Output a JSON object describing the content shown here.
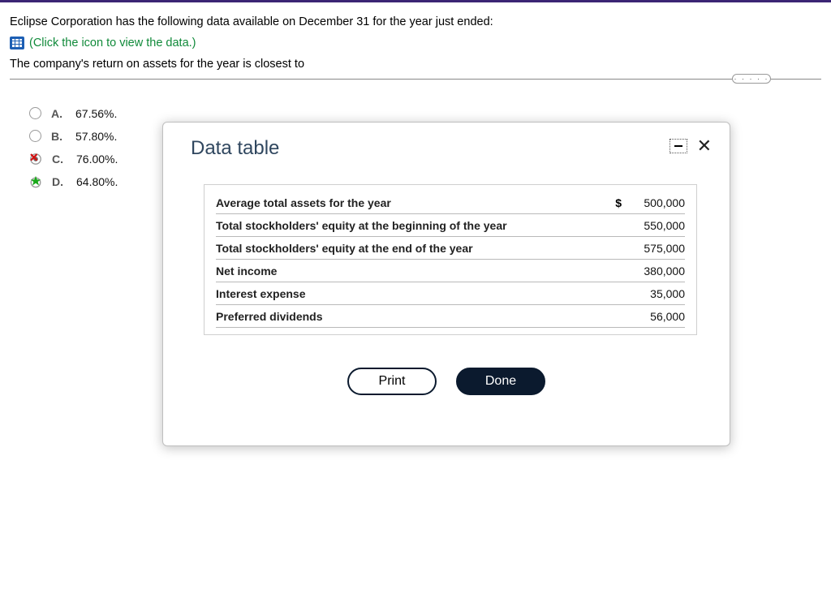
{
  "question": {
    "intro": "Eclipse Corporation has the following data available on December 31 for the year just ended:",
    "click_hint": "(Click the icon to view the data.)",
    "prompt": "The company's return on assets for the year is closest to"
  },
  "options": [
    {
      "letter": "A.",
      "text": "67.56%.",
      "state": "empty"
    },
    {
      "letter": "B.",
      "text": "57.80%.",
      "state": "empty"
    },
    {
      "letter": "C.",
      "text": "76.00%.",
      "state": "wrong"
    },
    {
      "letter": "D.",
      "text": "64.80%.",
      "state": "correct"
    }
  ],
  "modal": {
    "title": "Data table",
    "buttons": {
      "print": "Print",
      "done": "Done"
    }
  },
  "dots": "· · · · ·",
  "chart_data": {
    "type": "table",
    "title": "Data table",
    "currency_symbol": "$",
    "rows": [
      {
        "label": "Average total assets for the year",
        "show_currency": true,
        "value": "500,000"
      },
      {
        "label": "Total stockholders' equity at the beginning of the year",
        "show_currency": false,
        "value": "550,000"
      },
      {
        "label": "Total stockholders' equity at the end of the year",
        "show_currency": false,
        "value": "575,000"
      },
      {
        "label": "Net income",
        "show_currency": false,
        "value": "380,000"
      },
      {
        "label": "Interest expense",
        "show_currency": false,
        "value": "35,000"
      },
      {
        "label": "Preferred dividends",
        "show_currency": false,
        "value": "56,000"
      }
    ]
  }
}
